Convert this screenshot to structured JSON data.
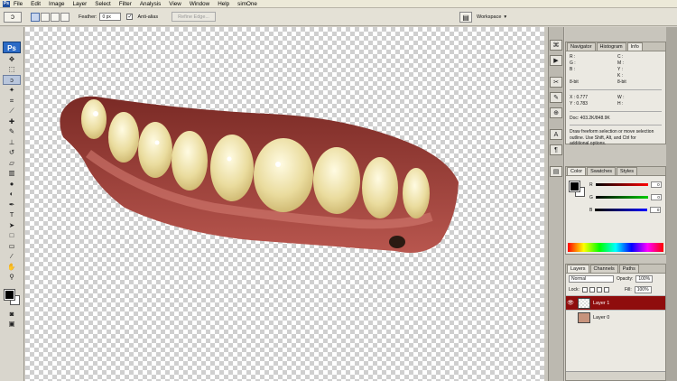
{
  "menu": [
    "File",
    "Edit",
    "Image",
    "Layer",
    "Select",
    "Filter",
    "Analysis",
    "View",
    "Window",
    "Help",
    "simOne"
  ],
  "options": {
    "feather_label": "Feather:",
    "feather_value": "0 px",
    "antialias_label": "Anti-alias",
    "refine_edge_label": "Refine Edge...",
    "workspace_label": "Workspace"
  },
  "toolbox": {
    "logo": "Ps"
  },
  "info_panel": {
    "tabs": [
      "Navigator",
      "Histogram",
      "Info"
    ],
    "rows": [
      {
        "a": "R :",
        "b": "C :"
      },
      {
        "a": "G :",
        "b": "M :"
      },
      {
        "a": "B :",
        "b": "Y :"
      },
      {
        "a": "",
        "b": "K :"
      },
      {
        "a": "8-bit",
        "b": "8-bit"
      },
      {
        "a": "X : 0.777",
        "b": "W :"
      },
      {
        "a": "Y : 0.783",
        "b": "H :"
      }
    ],
    "doc": "Doc: 403.2K/848.9K",
    "hint": "Draw freeform selection or move selection outline. Use Shift, Alt, and Ctrl for additional options."
  },
  "color_panel": {
    "tabs": [
      "Color",
      "Swatches",
      "Styles"
    ],
    "sliders": [
      {
        "label": "R",
        "color": "#d01010",
        "value": "0"
      },
      {
        "label": "G",
        "color": "#109010",
        "value": "0"
      },
      {
        "label": "B",
        "color": "#1020c0",
        "value": "0"
      }
    ]
  },
  "layers_panel": {
    "tabs": [
      "Layers",
      "Channels",
      "Paths"
    ],
    "blend_mode": "Normal",
    "opacity_label": "Opacity:",
    "opacity_value": "100%",
    "lock_label": "Lock:",
    "fill_label": "Fill:",
    "fill_value": "100%",
    "layers": [
      {
        "name": "Layer 1",
        "selected": true,
        "visible": true
      },
      {
        "name": "Layer 0",
        "selected": false,
        "visible": false
      }
    ]
  },
  "colors": {
    "selected_layer": "#8f0d0d",
    "brand": "#2c6bc6"
  }
}
